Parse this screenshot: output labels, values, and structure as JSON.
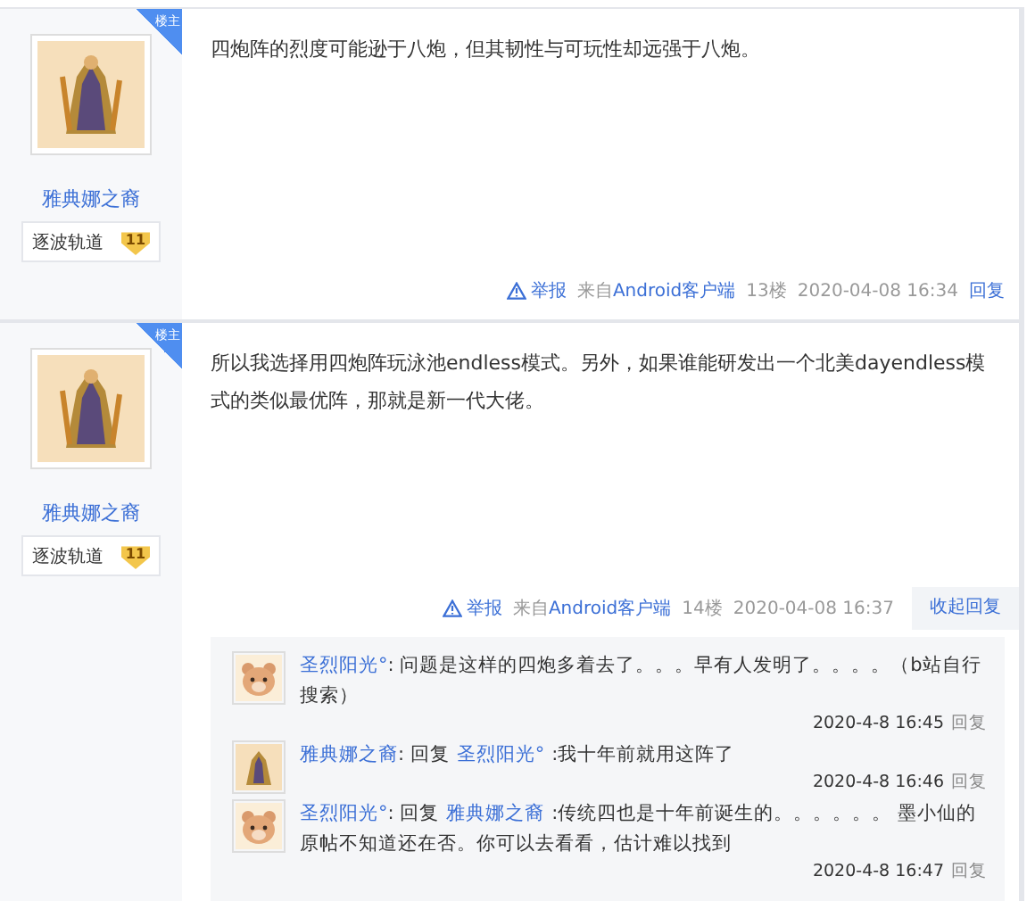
{
  "posts": [
    {
      "badge": "楼主",
      "author": "雅典娜之裔",
      "level_title": "逐波轨道",
      "level": "11",
      "content": [
        "四炮阵的烈度可能逊于八炮，但其韧性与可玩性却远强于八炮。"
      ],
      "footer": {
        "report": "举报",
        "source_prefix": "来自",
        "source": "Android客户端",
        "floor": "13楼",
        "time": "2020-04-08 16:34",
        "reply": "回复"
      }
    },
    {
      "badge": "楼主",
      "author": "雅典娜之裔",
      "level_title": "逐波轨道",
      "level": "11",
      "content": [
        "所以我选择用四炮阵玩泳池endless模式。另外，如果谁能研发出一个北美dayendless模式的类似最优阵，那就是新一代大佬。"
      ],
      "footer": {
        "report": "举报",
        "source_prefix": "来自",
        "source": "Android客户端",
        "floor": "14楼",
        "time": "2020-04-08 16:37",
        "toggle": "收起回复"
      },
      "comments": [
        {
          "kind": "bear",
          "author": "圣烈阳光°",
          "parts": [
            {
              "kind": "text",
              "text": ": 问题是这样的四炮多着去了。。。早有人发明了。。。。（b站自行搜索）"
            }
          ],
          "time": "2020-4-8 16:45",
          "reply": "回复"
        },
        {
          "kind": "figure",
          "author": "雅典娜之裔",
          "parts": [
            {
              "kind": "text",
              "text": ": 回复"
            },
            {
              "kind": "link",
              "text": "圣烈阳光°"
            },
            {
              "kind": "text",
              "text": ":我十年前就用这阵了"
            }
          ],
          "time": "2020-4-8 16:46",
          "reply": "回复"
        },
        {
          "kind": "bear",
          "author": "圣烈阳光°",
          "parts": [
            {
              "kind": "text",
              "text": ": 回复"
            },
            {
              "kind": "link",
              "text": "雅典娜之裔"
            },
            {
              "kind": "text",
              "text": ":传统四也是十年前诞生的。。。。。。 墨小仙的原帖不知道还在否。你可以去看看，估计难以找到"
            }
          ],
          "time": "2020-4-8 16:47",
          "reply": "回复"
        }
      ]
    }
  ]
}
